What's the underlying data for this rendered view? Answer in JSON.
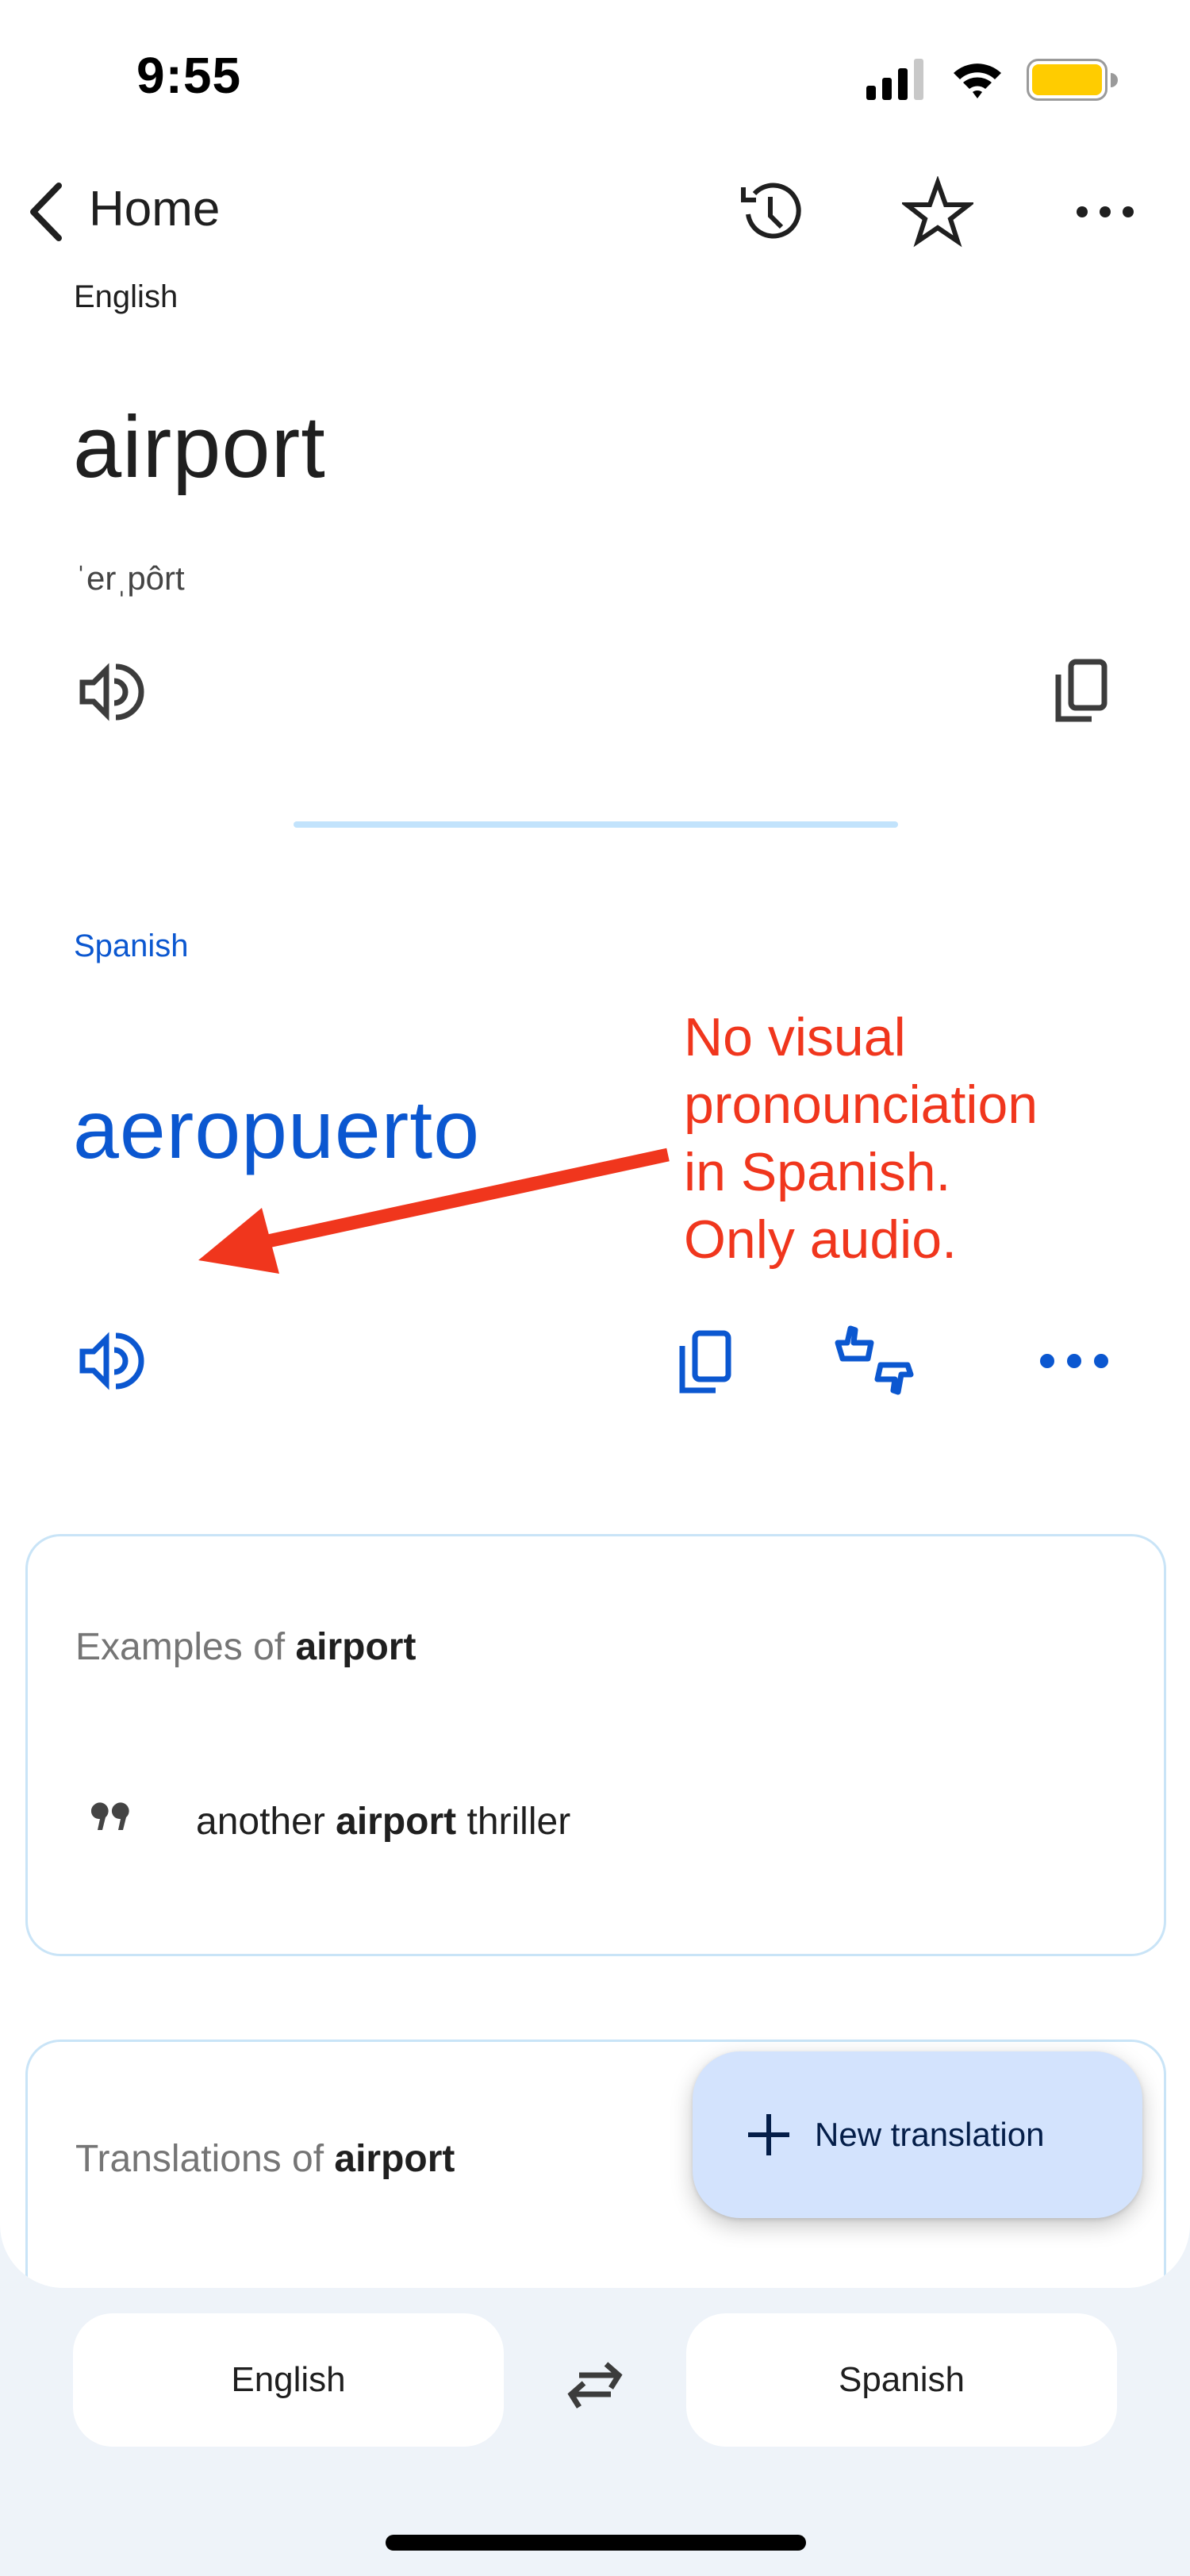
{
  "status_bar": {
    "time": "9:55",
    "signal_bars": 3,
    "signal_bars_total": 4,
    "wifi": "wifi-icon",
    "battery_level": 1.0,
    "battery_color": "#FFCC00"
  },
  "nav": {
    "back_label": "Home",
    "actions": [
      "history-icon",
      "star-icon",
      "more-icon"
    ]
  },
  "source": {
    "language": "English",
    "text": "airport",
    "phonetic": "ˈerˌpôrt",
    "actions": [
      "speaker-icon",
      "copy-icon"
    ]
  },
  "target": {
    "language": "Spanish",
    "text": "aeropuerto",
    "actions": [
      "speaker-icon",
      "copy-icon",
      "feedback-icon",
      "more-icon"
    ]
  },
  "annotation": {
    "text": "No visual\npronounciation\nin Spanish.\nOnly audio.",
    "color": "#F0361D"
  },
  "examples_card": {
    "title_prefix": "Examples of ",
    "title_word": "airport",
    "items": [
      {
        "before": "another ",
        "highlight": "airport",
        "after": " thriller"
      }
    ]
  },
  "translations_card": {
    "title_prefix": "Translations of ",
    "title_word": "airport"
  },
  "fab": {
    "label": "New translation",
    "icon": "plus-icon"
  },
  "language_bar": {
    "source": "English",
    "target": "Spanish",
    "swap_icon": "swap-icon"
  },
  "colors": {
    "accent": "#0B57D0",
    "divider": "#C2E3FC",
    "card_border": "#C9E4F7",
    "fab_bg": "#D3E3FD",
    "bottom_bg": "#EEF3F9"
  }
}
